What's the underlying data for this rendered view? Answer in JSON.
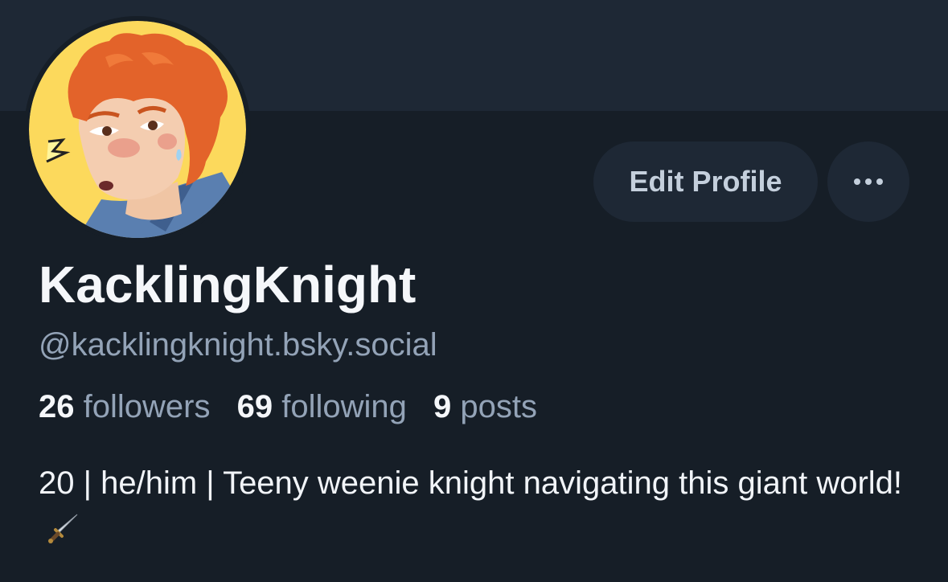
{
  "profile": {
    "display_name": "KacklingKnight",
    "handle": "@kacklingknight.bsky.social",
    "bio_text": "20 | he/him | Teeny weenie knight navigating this giant world!",
    "bio_emoji": "dagger-icon"
  },
  "stats": {
    "followers_count": "26",
    "followers_label": "followers",
    "following_count": "69",
    "following_label": "following",
    "posts_count": "9",
    "posts_label": "posts"
  },
  "actions": {
    "edit_profile_label": "Edit Profile",
    "more_icon": "ellipsis-icon"
  },
  "colors": {
    "background": "#161e27",
    "banner": "#1e2835",
    "button_bg": "#1e2835",
    "muted_text": "#93a3b7",
    "primary_text": "#f5f7fa",
    "avatar_bg": "#fcd95c",
    "avatar_hair": "#e3632a"
  }
}
